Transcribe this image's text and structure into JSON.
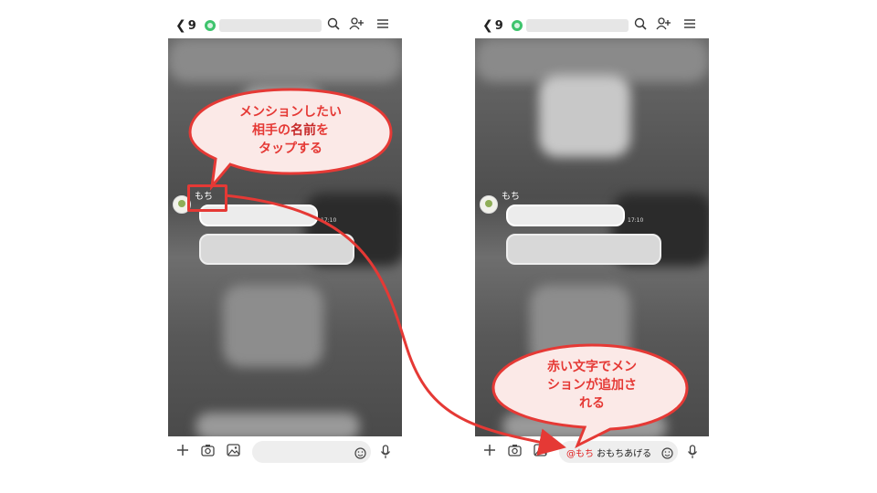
{
  "left_screen": {
    "back_count": "9",
    "name_label": "もち",
    "timestamp": "17:10",
    "callout": {
      "line1": "メンションしたい",
      "line2_prefix": "相手の",
      "line2_bold": "名前",
      "line2_suffix": "を",
      "line3": "タップする"
    }
  },
  "right_screen": {
    "back_count": "9",
    "name_label": "もち",
    "timestamp": "17:10",
    "input": {
      "mention": "@もち",
      "text": " おもちあげる"
    },
    "callout": {
      "line1": "赤い文字でメン",
      "line2": "ションが追加さ",
      "line3": "れる"
    }
  },
  "icons": {
    "back": "chevron-left-icon",
    "search": "search-icon",
    "add_friend": "add-friend-icon",
    "menu": "menu-icon",
    "plus": "plus-icon",
    "camera": "camera-icon",
    "image": "image-icon",
    "emoji": "emoji-icon",
    "mic": "mic-icon"
  },
  "colors": {
    "accent_red": "#e53935",
    "callout_fill": "#fbe9e7",
    "online_green": "#3ec46d"
  }
}
